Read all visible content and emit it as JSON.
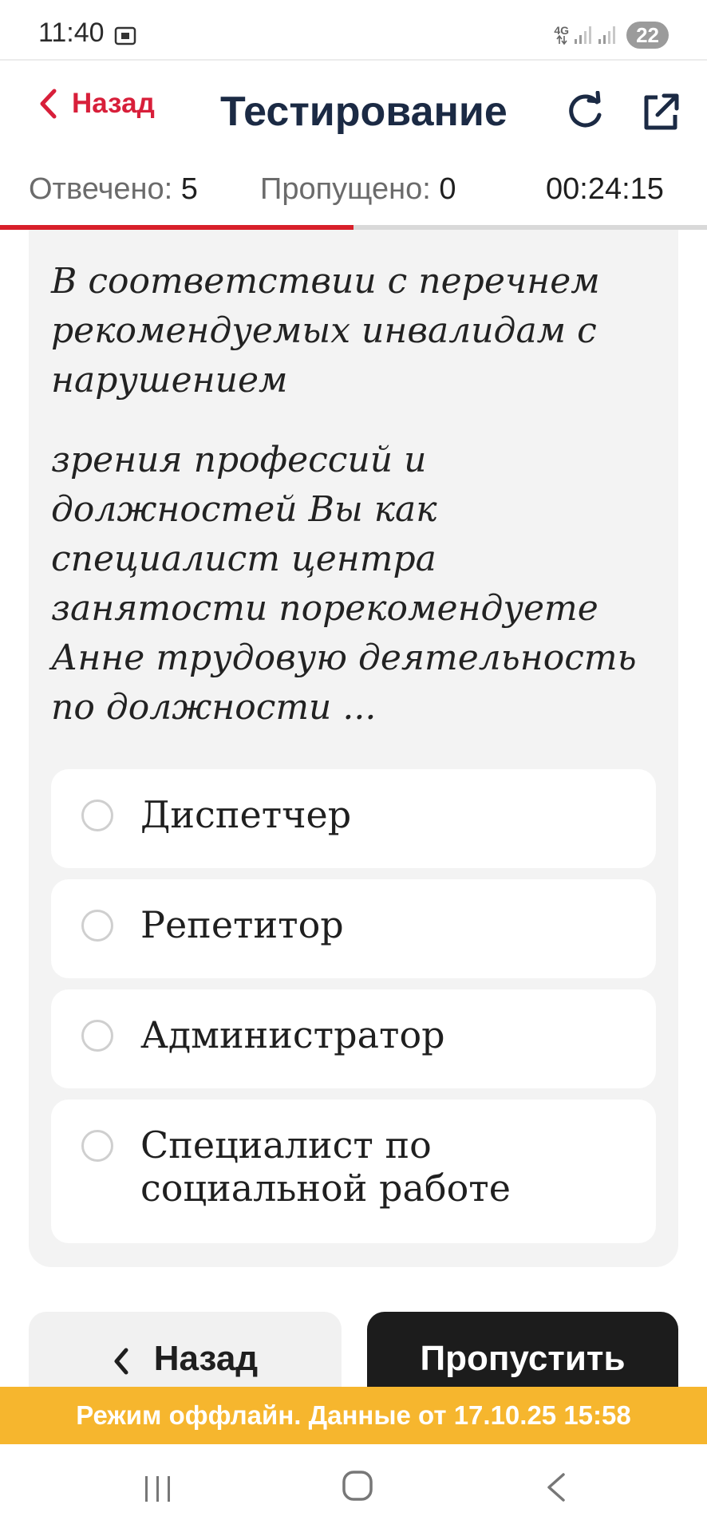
{
  "status_bar": {
    "time": "11:40",
    "network": "4G",
    "battery": "22",
    "icons": [
      "screenshot-icon",
      "signal-icon",
      "signal-icon"
    ]
  },
  "header": {
    "back_label": "Назад",
    "title": "Тестирование",
    "icons": [
      "refresh-icon",
      "open-external-icon"
    ]
  },
  "stats": {
    "answered_label": "Отвечено:",
    "answered_value": "5",
    "skipped_label": "Пропущено:",
    "skipped_value": "0",
    "timer": "00:24:15",
    "progress_fraction": 0.5
  },
  "question": {
    "paragraph_1": "В соответствии с перечнем рекомендуемых инвалидам с нарушением",
    "paragraph_2": "зрения профессий и должностей Вы как специалист центра занятости порекомендуете Анне трудовую деятельность по должности ..."
  },
  "options": [
    {
      "label": "Диспетчер",
      "selected": false
    },
    {
      "label": "Репетитор",
      "selected": false
    },
    {
      "label": "Администратор",
      "selected": false
    },
    {
      "label": "Специалист по социальной работе",
      "selected": false
    }
  ],
  "footer": {
    "back_label": "Назад",
    "skip_label": "Пропустить",
    "offline_text": "Режим оффлайн. Данные от 17.10.25 15:58"
  },
  "colors": {
    "accent": "#d81f3a",
    "title": "#1b2a44",
    "banner": "#f6b62e",
    "dark_button": "#1c1c1c"
  }
}
